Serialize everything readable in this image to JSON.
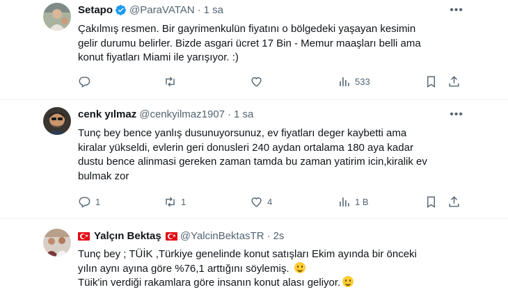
{
  "tweets": [
    {
      "name": "Setapo",
      "handle": "@ParaVATAN",
      "separator": "·",
      "time": "1 sa",
      "verified": true,
      "lines": [
        "Çakılmış resmen. Bir gayrimenkulün fiyatını o bölgedeki yaşayan kesimin",
        "gelir durumu belirler. Bizde asgari ücret 17 Bin - Memur maaşları belli ama",
        "konut fiyatları Miami ile yarışıyor. :)"
      ],
      "replies": "",
      "retweets": "",
      "likes": "",
      "views": "533"
    },
    {
      "name": "cenk yılmaz",
      "handle": "@cenkyilmaz1907",
      "separator": "·",
      "time": "1 sa",
      "verified": false,
      "lines": [
        "Tunç bey bence yanlış  dusunuyorsunuz, ev fiyatları deger kaybetti ama",
        "kiralar yükseldi, evlerin geri donusleri 240 aydan ortalama 180 aya kadar",
        "dustu bence alinmasi gereken zaman tamda bu zaman yatirim icin,kiralik ev",
        "bulmak zor"
      ],
      "replies": "1",
      "retweets": "1",
      "likes": "4",
      "views": "1 B"
    },
    {
      "name": "Yalçın Bektaş",
      "handle": "@YalcinBektasTR",
      "separator": "·",
      "time": "2s",
      "verified": false,
      "lines": [
        "Tunç bey ;  TÜİK ,Türkiye genelinde konut satışları Ekim ayında bir önceki",
        "yılın aynı ayına göre %76,1 arttığını söylemiş.",
        "Tüik'in verdiği rakamlara göre insanın konut alası geliyor."
      ]
    }
  ],
  "icons": {
    "more": "more-icon",
    "reply": "reply-icon",
    "retweet": "retweet-icon",
    "like": "heart-icon",
    "views": "views-icon",
    "bookmark": "bookmark-icon",
    "share": "share-icon",
    "verified": "verified-badge-icon",
    "flag": "turkey-flag-icon",
    "emoji": "smile-emoji-icon"
  },
  "colors": {
    "text": "#0f1419",
    "secondary": "#536471",
    "verified": "#1d9bf0",
    "divider": "#eff3f4",
    "flag": "#e30a17"
  }
}
